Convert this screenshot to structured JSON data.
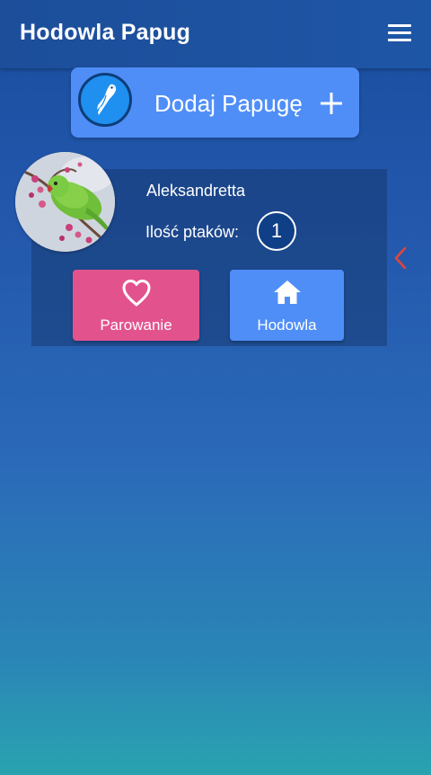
{
  "appbar": {
    "title": "Hodowla Papug",
    "menu_icon": "hamburger-menu-icon"
  },
  "add_parrot": {
    "label": "Dodaj Papugę",
    "logo_icon": "parrot-logo-icon",
    "plus_icon": "plus-icon"
  },
  "bird_card": {
    "name": "Aleksandretta",
    "count_label": "Ilość ptaków:",
    "count": "1",
    "avatar": "green-parrot-photo"
  },
  "actions": {
    "pairing_label": "Parowanie",
    "pairing_icon": "heart-outline-icon",
    "breeding_label": "Hodowla",
    "breeding_icon": "home-icon"
  },
  "side": {
    "chevron_icon": "chevron-left-icon"
  },
  "colors": {
    "appbar": "#1c4e9a",
    "primary_button": "#4f8ef7",
    "pairing_button": "#e2538e",
    "chevron": "#e0453c"
  }
}
